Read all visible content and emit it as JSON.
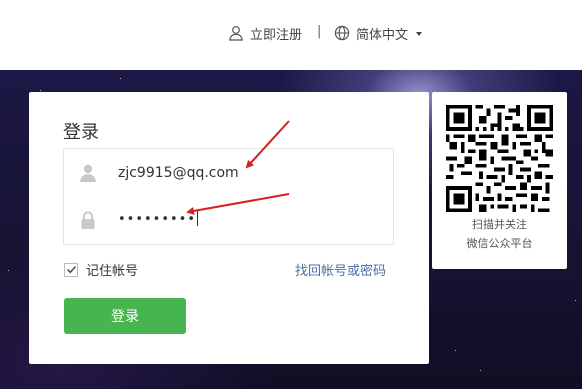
{
  "header": {
    "register_label": "立即注册",
    "separator": "|",
    "language_label": "简体中文",
    "icons": {
      "register": "user-icon",
      "language": "globe-icon",
      "language_dropdown": "caret-down-icon"
    }
  },
  "login": {
    "title": "登录",
    "username_value": "zjc9915@qq.com",
    "password_value": "•••••••••",
    "icons": {
      "username": "user-icon",
      "password": "lock-icon"
    },
    "remember_label": "记住帐号",
    "remember_checked": true,
    "forgot_label": "找回帐号或密码",
    "submit_label": "登录",
    "accent_color": "#47b54f"
  },
  "qr": {
    "line1": "扫描并关注",
    "line2": "微信公众平台"
  },
  "annotations": {
    "arrow_color": "#d42020"
  }
}
